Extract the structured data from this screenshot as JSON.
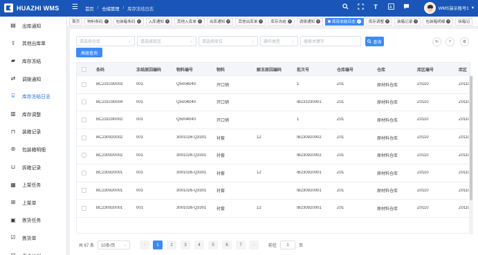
{
  "brand": {
    "name": "HUAZHI WMS"
  },
  "breadcrumb": {
    "home": "首页",
    "parent": "仓储管理",
    "current": "库存冻结日志"
  },
  "user": {
    "name": "WMS演示账号1"
  },
  "top_icons": [
    "search-icon",
    "fullscreen-icon",
    "font-size-icon",
    "translate-icon",
    "message-icon"
  ],
  "sidebar": {
    "items": [
      {
        "label": "出库通知",
        "icon": "notice-icon"
      },
      {
        "label": "其他出库单",
        "icon": "outbound-icon"
      },
      {
        "label": "库存冻结",
        "icon": "lock-icon"
      },
      {
        "label": "调拨通知",
        "icon": "transfer-icon"
      },
      {
        "label": "库存冻结日志",
        "icon": "log-icon",
        "active": true
      },
      {
        "label": "库存调整",
        "icon": "adjust-icon"
      },
      {
        "label": "装箱记录",
        "icon": "box-icon"
      },
      {
        "label": "包装箱明细",
        "icon": "package-icon"
      },
      {
        "label": "拆箱记录",
        "icon": "unbox-icon"
      },
      {
        "label": "上架任务",
        "icon": "task-icon"
      },
      {
        "label": "上架单",
        "icon": "shelf-icon"
      },
      {
        "label": "拣货任务",
        "icon": "pick-task-icon"
      },
      {
        "label": "拣货单",
        "icon": "pick-list-icon"
      },
      {
        "label": "盘点计划",
        "icon": "inventory-plan-icon"
      }
    ]
  },
  "tabs": [
    {
      "label": "首页",
      "closable": false
    },
    {
      "label": "物料条码",
      "closable": true
    },
    {
      "label": "包装箱条码",
      "closable": true
    },
    {
      "label": "入库通知",
      "closable": true
    },
    {
      "label": "其他入库单",
      "closable": true
    },
    {
      "label": "出库通知",
      "closable": true
    },
    {
      "label": "其他出库单",
      "closable": true
    },
    {
      "label": "库存冻结",
      "closable": true
    },
    {
      "label": "调拨通知",
      "closable": true
    },
    {
      "label": "库存冻结日志",
      "closable": true,
      "active": true
    },
    {
      "label": "库存调整",
      "closable": true
    },
    {
      "label": "装箱记录",
      "closable": true
    },
    {
      "label": "包装箱明细",
      "closable": true
    },
    {
      "label": "拆箱记",
      "closable": false
    }
  ],
  "filters": {
    "warehouse_placeholder": "请选择仓库",
    "area_placeholder": "请选择库区",
    "location_placeholder": "请选择库位",
    "op_type_placeholder": "操作类型",
    "keyword_placeholder": "搜索关键字",
    "search_label": "查询",
    "advanced_label": "高级查询"
  },
  "table": {
    "columns": [
      "条码",
      "冻结原因编码",
      "物料编号",
      "物料",
      "解冻原因编码",
      "批次号",
      "仓库编号",
      "仓库",
      "库区编号",
      "库区"
    ],
    "rows": [
      [
        "BC231030003",
        "001",
        "Q5004040",
        "开口销",
        "",
        "1",
        "Z01",
        "原材料仓库",
        "Z0110",
        "Z0110"
      ],
      [
        "BC231030004",
        "001",
        "Q5004040",
        "开口销",
        "",
        "IB231030001",
        "Z01",
        "原材料仓库",
        "Z0110",
        "Z0110"
      ],
      [
        "BC231030002",
        "001",
        "Q5004040",
        "开口销",
        "",
        "1",
        "Z01",
        "原材料仓库",
        "Z0110",
        "Z0110"
      ],
      [
        "BC230920002",
        "001",
        "3001026-Q3301",
        "衬套",
        "12",
        "IB230920002",
        "Z01",
        "原材料仓库",
        "Z0110",
        "Z0110"
      ],
      [
        "BC230920002",
        "001",
        "3001026-Q3301",
        "衬套",
        "",
        "IB230920002",
        "Z01",
        "原材料仓库",
        "Z0110",
        "Z0110"
      ],
      [
        "BC230920001",
        "001",
        "3001026-Q3301",
        "衬套",
        "12",
        "IB230920001",
        "Z01",
        "原材料仓库",
        "Z0110",
        "Z0110"
      ],
      [
        "BC230920001",
        "001",
        "3001026-Q3301",
        "衬套",
        "",
        "IB230920001",
        "Z01",
        "原材料仓库",
        "Z0110",
        "Z0110"
      ],
      [
        "BC230920001",
        "001",
        "3001026-Q3301",
        "衬套",
        "12",
        "IB230920001",
        "Z01",
        "原材料仓库",
        "Z0110",
        "Z0110"
      ]
    ]
  },
  "pagination": {
    "total_label": "共 67 条",
    "page_size": "10条/页",
    "pages": [
      "1",
      "2",
      "3",
      "4",
      "5",
      "6",
      "7"
    ],
    "current_page": "1",
    "goto_label": "前往",
    "goto_value": "1",
    "page_suffix": "页"
  }
}
